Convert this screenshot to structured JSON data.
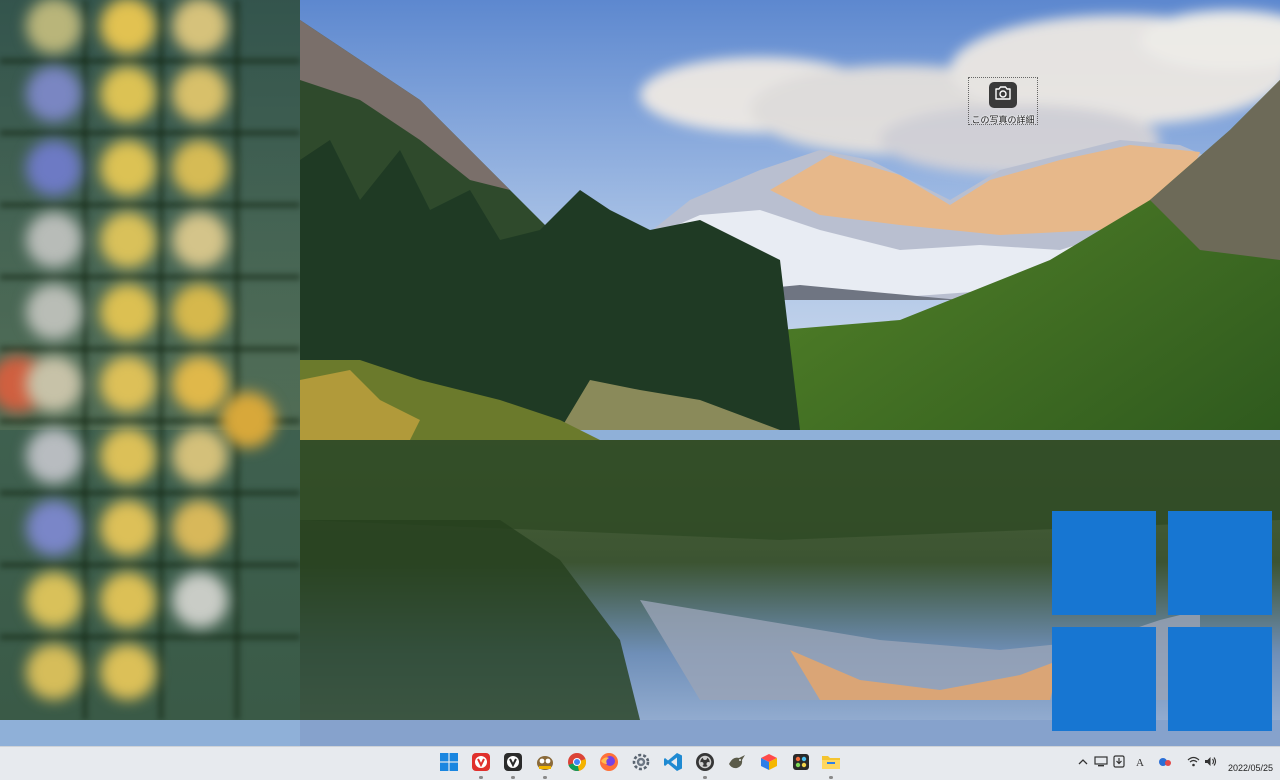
{
  "desktop": {
    "wallpaper": "maroon-bells-lake-landscape",
    "capture_widget": {
      "icon": "camera-icon",
      "label": "この写真の詳細"
    },
    "overlay_logo": "windows-logo",
    "colors": {
      "logo_blue": "#1776d2"
    }
  },
  "taskbar": {
    "pinned_apps": [
      {
        "name": "start",
        "icon": "windows-start-icon"
      },
      {
        "name": "vivaldi",
        "icon": "vivaldi-icon"
      },
      {
        "name": "vivaldi-snapshot",
        "icon": "vivaldi-snapshot-icon"
      },
      {
        "name": "gimp",
        "icon": "gimp-icon"
      },
      {
        "name": "chrome",
        "icon": "chrome-icon"
      },
      {
        "name": "firefox",
        "icon": "firefox-icon"
      },
      {
        "name": "settings",
        "icon": "gear-icon"
      },
      {
        "name": "vscode",
        "icon": "vscode-icon"
      },
      {
        "name": "obs",
        "icon": "obs-icon"
      },
      {
        "name": "app-bird",
        "icon": "bird-icon"
      },
      {
        "name": "app-colorful",
        "icon": "colorful-app-icon"
      },
      {
        "name": "app-dark",
        "icon": "dark-app-icon"
      },
      {
        "name": "file-explorer",
        "icon": "folder-icon"
      }
    ],
    "tray": {
      "input_indicator": "A",
      "date": "2022/05/25"
    }
  }
}
